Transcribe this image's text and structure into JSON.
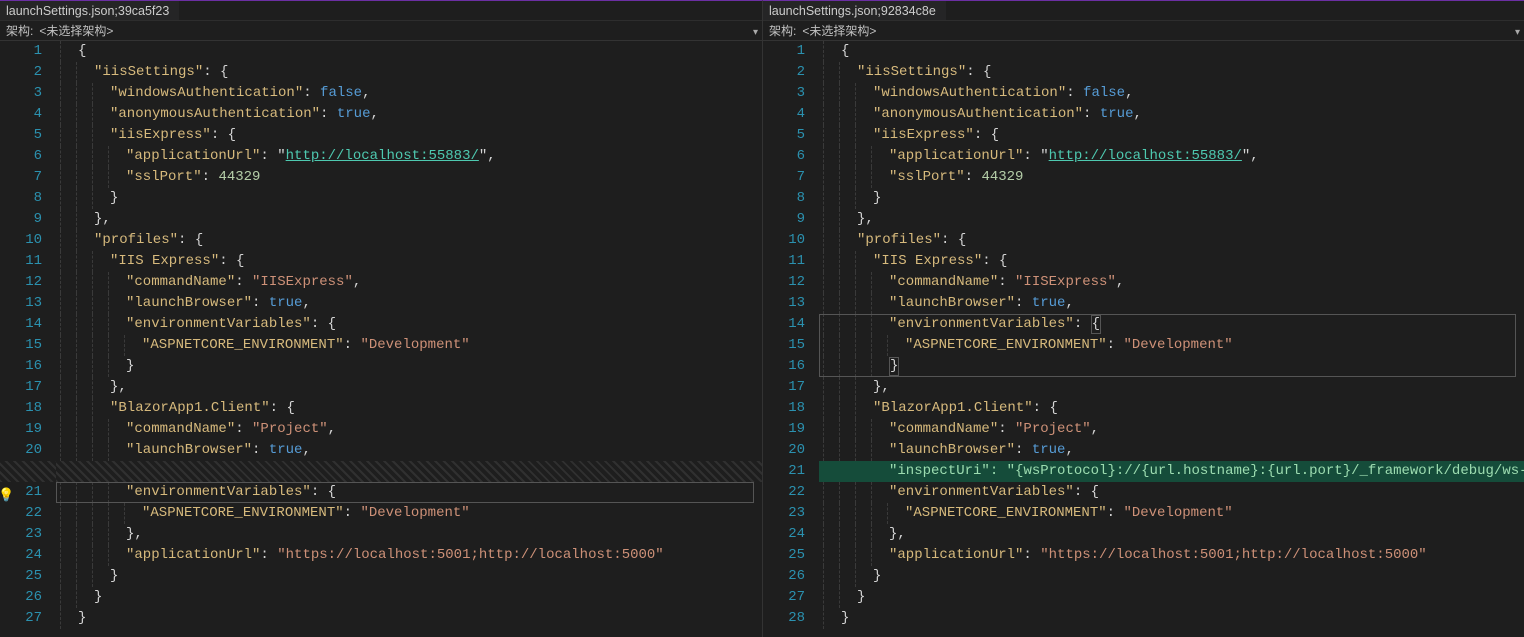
{
  "panes": [
    {
      "tab": "launchSettings.json;39ca5f23",
      "arch_label": "架构:",
      "arch_value": "<未选择架构>"
    },
    {
      "tab": "launchSettings.json;92834c8e",
      "arch_label": "架构:",
      "arch_value": "<未选择架构>"
    }
  ],
  "left": {
    "lines": [
      {
        "n": 1,
        "ind": 1,
        "tok": [
          [
            "p",
            "{"
          ]
        ]
      },
      {
        "n": 2,
        "ind": 2,
        "tok": [
          [
            "k",
            "\"iisSettings\""
          ],
          [
            "p",
            ": {"
          ]
        ]
      },
      {
        "n": 3,
        "ind": 3,
        "tok": [
          [
            "k",
            "\"windowsAuthentication\""
          ],
          [
            "p",
            ": "
          ],
          [
            "b",
            "false"
          ],
          [
            "p",
            ","
          ]
        ]
      },
      {
        "n": 4,
        "ind": 3,
        "tok": [
          [
            "k",
            "\"anonymousAuthentication\""
          ],
          [
            "p",
            ": "
          ],
          [
            "b",
            "true"
          ],
          [
            "p",
            ","
          ]
        ]
      },
      {
        "n": 5,
        "ind": 3,
        "tok": [
          [
            "k",
            "\"iisExpress\""
          ],
          [
            "p",
            ": {"
          ]
        ]
      },
      {
        "n": 6,
        "ind": 4,
        "tok": [
          [
            "k",
            "\"applicationUrl\""
          ],
          [
            "p",
            ": \""
          ],
          [
            "u",
            "http://localhost:55883/"
          ],
          [
            "p",
            "\","
          ]
        ]
      },
      {
        "n": 7,
        "ind": 4,
        "tok": [
          [
            "k",
            "\"sslPort\""
          ],
          [
            "p",
            ": "
          ],
          [
            "n",
            "44329"
          ]
        ]
      },
      {
        "n": 8,
        "ind": 3,
        "tok": [
          [
            "p",
            "}"
          ]
        ]
      },
      {
        "n": 9,
        "ind": 2,
        "tok": [
          [
            "p",
            "},"
          ]
        ]
      },
      {
        "n": 10,
        "ind": 2,
        "tok": [
          [
            "k",
            "\"profiles\""
          ],
          [
            "p",
            ": {"
          ]
        ]
      },
      {
        "n": 11,
        "ind": 3,
        "tok": [
          [
            "k",
            "\"IIS Express\""
          ],
          [
            "p",
            ": {"
          ]
        ]
      },
      {
        "n": 12,
        "ind": 4,
        "tok": [
          [
            "k",
            "\"commandName\""
          ],
          [
            "p",
            ": "
          ],
          [
            "s",
            "\"IISExpress\""
          ],
          [
            "p",
            ","
          ]
        ]
      },
      {
        "n": 13,
        "ind": 4,
        "tok": [
          [
            "k",
            "\"launchBrowser\""
          ],
          [
            "p",
            ": "
          ],
          [
            "b",
            "true"
          ],
          [
            "p",
            ","
          ]
        ]
      },
      {
        "n": 14,
        "ind": 4,
        "tok": [
          [
            "k",
            "\"environmentVariables\""
          ],
          [
            "p",
            ": {"
          ]
        ]
      },
      {
        "n": 15,
        "ind": 5,
        "tok": [
          [
            "k",
            "\"ASPNETCORE_ENVIRONMENT\""
          ],
          [
            "p",
            ": "
          ],
          [
            "s",
            "\"Development\""
          ]
        ]
      },
      {
        "n": 16,
        "ind": 4,
        "tok": [
          [
            "p",
            "}"
          ]
        ]
      },
      {
        "n": 17,
        "ind": 3,
        "tok": [
          [
            "p",
            "},"
          ]
        ]
      },
      {
        "n": 18,
        "ind": 3,
        "tok": [
          [
            "k",
            "\"BlazorApp1.Client\""
          ],
          [
            "p",
            ": {"
          ]
        ]
      },
      {
        "n": 19,
        "ind": 4,
        "tok": [
          [
            "k",
            "\"commandName\""
          ],
          [
            "p",
            ": "
          ],
          [
            "s",
            "\"Project\""
          ],
          [
            "p",
            ","
          ]
        ]
      },
      {
        "n": 20,
        "ind": 4,
        "tok": [
          [
            "k",
            "\"launchBrowser\""
          ],
          [
            "p",
            ": "
          ],
          [
            "b",
            "true"
          ],
          [
            "p",
            ","
          ]
        ]
      },
      {
        "n": "gap",
        "gap": true
      },
      {
        "n": 21,
        "ind": 4,
        "cur": true,
        "tok": [
          [
            "k",
            "\"environmentVariables\""
          ],
          [
            "p",
            ": {"
          ]
        ]
      },
      {
        "n": 22,
        "ind": 5,
        "tok": [
          [
            "k",
            "\"ASPNETCORE_ENVIRONMENT\""
          ],
          [
            "p",
            ": "
          ],
          [
            "s",
            "\"Development\""
          ]
        ]
      },
      {
        "n": 23,
        "ind": 4,
        "tok": [
          [
            "p",
            "},"
          ]
        ]
      },
      {
        "n": 24,
        "ind": 4,
        "tok": [
          [
            "k",
            "\"applicationUrl\""
          ],
          [
            "p",
            ": "
          ],
          [
            "s",
            "\"https://localhost:5001;http://localhost:5000\""
          ]
        ]
      },
      {
        "n": 25,
        "ind": 3,
        "tok": [
          [
            "p",
            "}"
          ]
        ]
      },
      {
        "n": 26,
        "ind": 2,
        "tok": [
          [
            "p",
            "}"
          ]
        ]
      },
      {
        "n": 27,
        "ind": 1,
        "tok": [
          [
            "p",
            "}"
          ]
        ]
      }
    ]
  },
  "right": {
    "selbox": {
      "from": 14,
      "to": 16
    },
    "lines": [
      {
        "n": 1,
        "ind": 1,
        "tok": [
          [
            "p",
            "{"
          ]
        ]
      },
      {
        "n": 2,
        "ind": 2,
        "tok": [
          [
            "k",
            "\"iisSettings\""
          ],
          [
            "p",
            ": {"
          ]
        ]
      },
      {
        "n": 3,
        "ind": 3,
        "tok": [
          [
            "k",
            "\"windowsAuthentication\""
          ],
          [
            "p",
            ": "
          ],
          [
            "b",
            "false"
          ],
          [
            "p",
            ","
          ]
        ]
      },
      {
        "n": 4,
        "ind": 3,
        "tok": [
          [
            "k",
            "\"anonymousAuthentication\""
          ],
          [
            "p",
            ": "
          ],
          [
            "b",
            "true"
          ],
          [
            "p",
            ","
          ]
        ]
      },
      {
        "n": 5,
        "ind": 3,
        "tok": [
          [
            "k",
            "\"iisExpress\""
          ],
          [
            "p",
            ": {"
          ]
        ]
      },
      {
        "n": 6,
        "ind": 4,
        "tok": [
          [
            "k",
            "\"applicationUrl\""
          ],
          [
            "p",
            ": \""
          ],
          [
            "u",
            "http://localhost:55883/"
          ],
          [
            "p",
            "\","
          ]
        ]
      },
      {
        "n": 7,
        "ind": 4,
        "tok": [
          [
            "k",
            "\"sslPort\""
          ],
          [
            "p",
            ": "
          ],
          [
            "n",
            "44329"
          ]
        ]
      },
      {
        "n": 8,
        "ind": 3,
        "tok": [
          [
            "p",
            "}"
          ]
        ]
      },
      {
        "n": 9,
        "ind": 2,
        "tok": [
          [
            "p",
            "},"
          ]
        ]
      },
      {
        "n": 10,
        "ind": 2,
        "tok": [
          [
            "k",
            "\"profiles\""
          ],
          [
            "p",
            ": {"
          ]
        ]
      },
      {
        "n": 11,
        "ind": 3,
        "tok": [
          [
            "k",
            "\"IIS Express\""
          ],
          [
            "p",
            ": {"
          ]
        ]
      },
      {
        "n": 12,
        "ind": 4,
        "tok": [
          [
            "k",
            "\"commandName\""
          ],
          [
            "p",
            ": "
          ],
          [
            "s",
            "\"IISExpress\""
          ],
          [
            "p",
            ","
          ]
        ]
      },
      {
        "n": 13,
        "ind": 4,
        "tok": [
          [
            "k",
            "\"launchBrowser\""
          ],
          [
            "p",
            ": "
          ],
          [
            "b",
            "true"
          ],
          [
            "p",
            ","
          ]
        ]
      },
      {
        "n": 14,
        "ind": 4,
        "tok": [
          [
            "k",
            "\"environmentVariables\""
          ],
          [
            "p",
            ": "
          ],
          [
            "p-brkt",
            "{"
          ]
        ]
      },
      {
        "n": 15,
        "ind": 5,
        "tok": [
          [
            "k",
            "\"ASPNETCORE_ENVIRONMENT\""
          ],
          [
            "p",
            ": "
          ],
          [
            "s",
            "\"Development\""
          ]
        ]
      },
      {
        "n": 16,
        "ind": 4,
        "tok": [
          [
            "p-brkt",
            "}"
          ]
        ]
      },
      {
        "n": 17,
        "ind": 3,
        "tok": [
          [
            "p",
            "},"
          ]
        ]
      },
      {
        "n": 18,
        "ind": 3,
        "tok": [
          [
            "k",
            "\"BlazorApp1.Client\""
          ],
          [
            "p",
            ": {"
          ]
        ]
      },
      {
        "n": 19,
        "ind": 4,
        "tok": [
          [
            "k",
            "\"commandName\""
          ],
          [
            "p",
            ": "
          ],
          [
            "s",
            "\"Project\""
          ],
          [
            "p",
            ","
          ]
        ]
      },
      {
        "n": 20,
        "ind": 4,
        "tok": [
          [
            "k",
            "\"launchBrowser\""
          ],
          [
            "p",
            ": "
          ],
          [
            "b",
            "true"
          ],
          [
            "p",
            ","
          ]
        ]
      },
      {
        "n": 21,
        "ind": 4,
        "add": true,
        "tok": [
          [
            "k",
            "\"inspectUri\""
          ],
          [
            "p",
            ": "
          ],
          [
            "s",
            "\"{wsProtocol}://{url.hostname}:{url.port}/_framework/debug/ws-proxy?browser={browserInspectU"
          ]
        ]
      },
      {
        "n": 22,
        "ind": 4,
        "tok": [
          [
            "k",
            "\"environmentVariables\""
          ],
          [
            "p",
            ": {"
          ]
        ]
      },
      {
        "n": 23,
        "ind": 5,
        "tok": [
          [
            "k",
            "\"ASPNETCORE_ENVIRONMENT\""
          ],
          [
            "p",
            ": "
          ],
          [
            "s",
            "\"Development\""
          ]
        ]
      },
      {
        "n": 24,
        "ind": 4,
        "tok": [
          [
            "p",
            "},"
          ]
        ]
      },
      {
        "n": 25,
        "ind": 4,
        "tok": [
          [
            "k",
            "\"applicationUrl\""
          ],
          [
            "p",
            ": "
          ],
          [
            "s",
            "\"https://localhost:5001;http://localhost:5000\""
          ]
        ]
      },
      {
        "n": 26,
        "ind": 3,
        "tok": [
          [
            "p",
            "}"
          ]
        ]
      },
      {
        "n": 27,
        "ind": 2,
        "tok": [
          [
            "p",
            "}"
          ]
        ]
      },
      {
        "n": 28,
        "ind": 1,
        "tok": [
          [
            "p",
            "}"
          ]
        ]
      }
    ]
  }
}
